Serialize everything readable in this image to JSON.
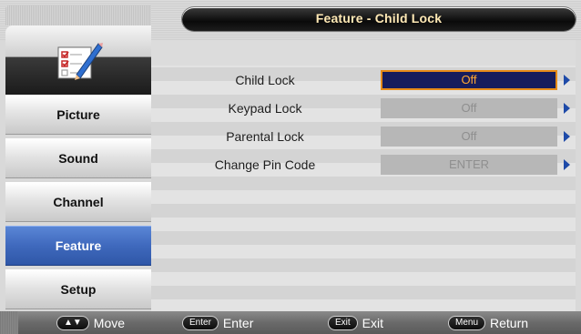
{
  "title": "Feature - Child Lock",
  "sidebar": {
    "items": [
      {
        "label": "Picture",
        "active": false
      },
      {
        "label": "Sound",
        "active": false
      },
      {
        "label": "Channel",
        "active": false
      },
      {
        "label": "Feature",
        "active": true
      },
      {
        "label": "Setup",
        "active": false
      }
    ]
  },
  "rows": [
    {
      "label": "Child Lock",
      "value": "Off",
      "selected": true
    },
    {
      "label": "Keypad Lock",
      "value": "Off",
      "selected": false
    },
    {
      "label": "Parental Lock",
      "value": "Off",
      "selected": false
    },
    {
      "label": "Change Pin Code",
      "value": "ENTER",
      "selected": false
    }
  ],
  "footer": {
    "hints": [
      {
        "key": "▲▼",
        "label": "Move"
      },
      {
        "key": "Enter",
        "label": "Enter"
      },
      {
        "key": "Exit",
        "label": "Exit"
      },
      {
        "key": "Menu",
        "label": "Return"
      }
    ]
  },
  "colors": {
    "active_menu": "#3f69bd",
    "selected_value_bg": "#161c5c",
    "selected_value_text": "#ffa733",
    "title_text": "#ffe9b5",
    "arrow": "#1e4aa8"
  },
  "icons": {
    "logo": "checklist-pencil-icon",
    "row_arrow": "triangle-right-icon"
  }
}
